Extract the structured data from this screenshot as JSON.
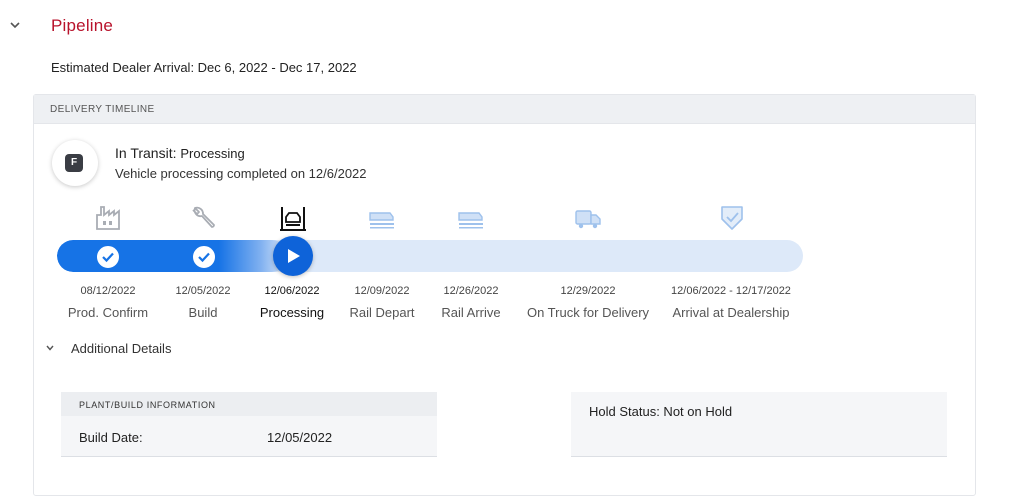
{
  "section": {
    "title": "Pipeline",
    "estimated_arrival": "Estimated Dealer Arrival: Dec 6, 2022 - Dec 17, 2022"
  },
  "timeline": {
    "header": "DELIVERY TIMELINE",
    "brand_letter": "F",
    "status_label": "In Transit:",
    "status_value": "Processing",
    "status_detail": "Vehicle processing completed on 12/6/2022",
    "progress_fraction": 0.31,
    "accent_color": "#1673e6",
    "stages": [
      {
        "label": "Prod. Confirm",
        "date": "08/12/2022",
        "state": "complete",
        "icon": "factory-icon"
      },
      {
        "label": "Build",
        "date": "12/05/2022",
        "state": "complete",
        "icon": "wrench-icon"
      },
      {
        "label": "Processing",
        "date": "12/06/2022",
        "state": "current",
        "icon": "vehicle-lift-icon"
      },
      {
        "label": "Rail Depart",
        "date": "12/09/2022",
        "state": "upcoming",
        "icon": "rail-car-icon"
      },
      {
        "label": "Rail Arrive",
        "date": "12/26/2022",
        "state": "upcoming",
        "icon": "rail-car-icon"
      },
      {
        "label": "On Truck for Delivery",
        "date": "12/29/2022",
        "state": "upcoming",
        "icon": "truck-icon"
      },
      {
        "label": "Arrival at Dealership",
        "date": "12/06/2022 - 12/17/2022",
        "state": "upcoming",
        "icon": "shield-check-icon"
      }
    ]
  },
  "additional_details": {
    "label": "Additional Details",
    "plant": {
      "header": "PLANT/BUILD INFORMATION",
      "build_date_label": "Build Date:",
      "build_date_value": "12/05/2022"
    },
    "hold_status": "Hold Status: Not on Hold"
  }
}
